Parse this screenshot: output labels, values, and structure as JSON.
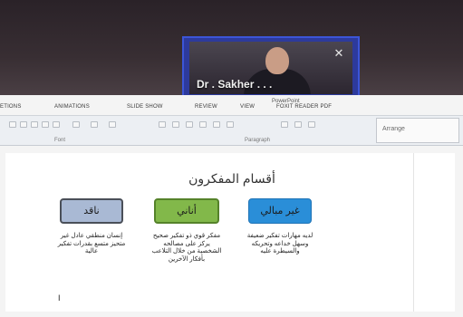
{
  "video_call": {
    "participant_name": "Dr . Sakher . . .",
    "expand_icon": "expand-arrows-icon"
  },
  "ppt": {
    "window_title": "PowerPoint",
    "tabs": [
      "ETIONS",
      "ANIMATIONS",
      "SLIDE SHOW",
      "REVIEW",
      "VIEW",
      "FOXIT READER PDF"
    ],
    "group_labels": [
      "Font",
      "Paragraph"
    ],
    "arrange_label": "Arrange"
  },
  "slide": {
    "title": "أقسام المفكرون",
    "boxes": [
      {
        "label": "ناقد",
        "color": "#a9b9d4"
      },
      {
        "label": "أناني",
        "color": "#82b84a"
      },
      {
        "label": "غير مبالي",
        "color": "#2a8ed8"
      }
    ],
    "descriptions": [
      "إنسان منطقي عادل غير متحيز متسع بقدرات تفكير عالية",
      "مفكر قوي ذو تفكير صحيح يركز على مصالحه الشخصية من خلال التلاعب بأفكار الآخرين",
      "لديه مهارات تفكير ضعيفة وسهل خداعه وتحريكه والسيطرة عليه"
    ],
    "cursor": "I"
  }
}
